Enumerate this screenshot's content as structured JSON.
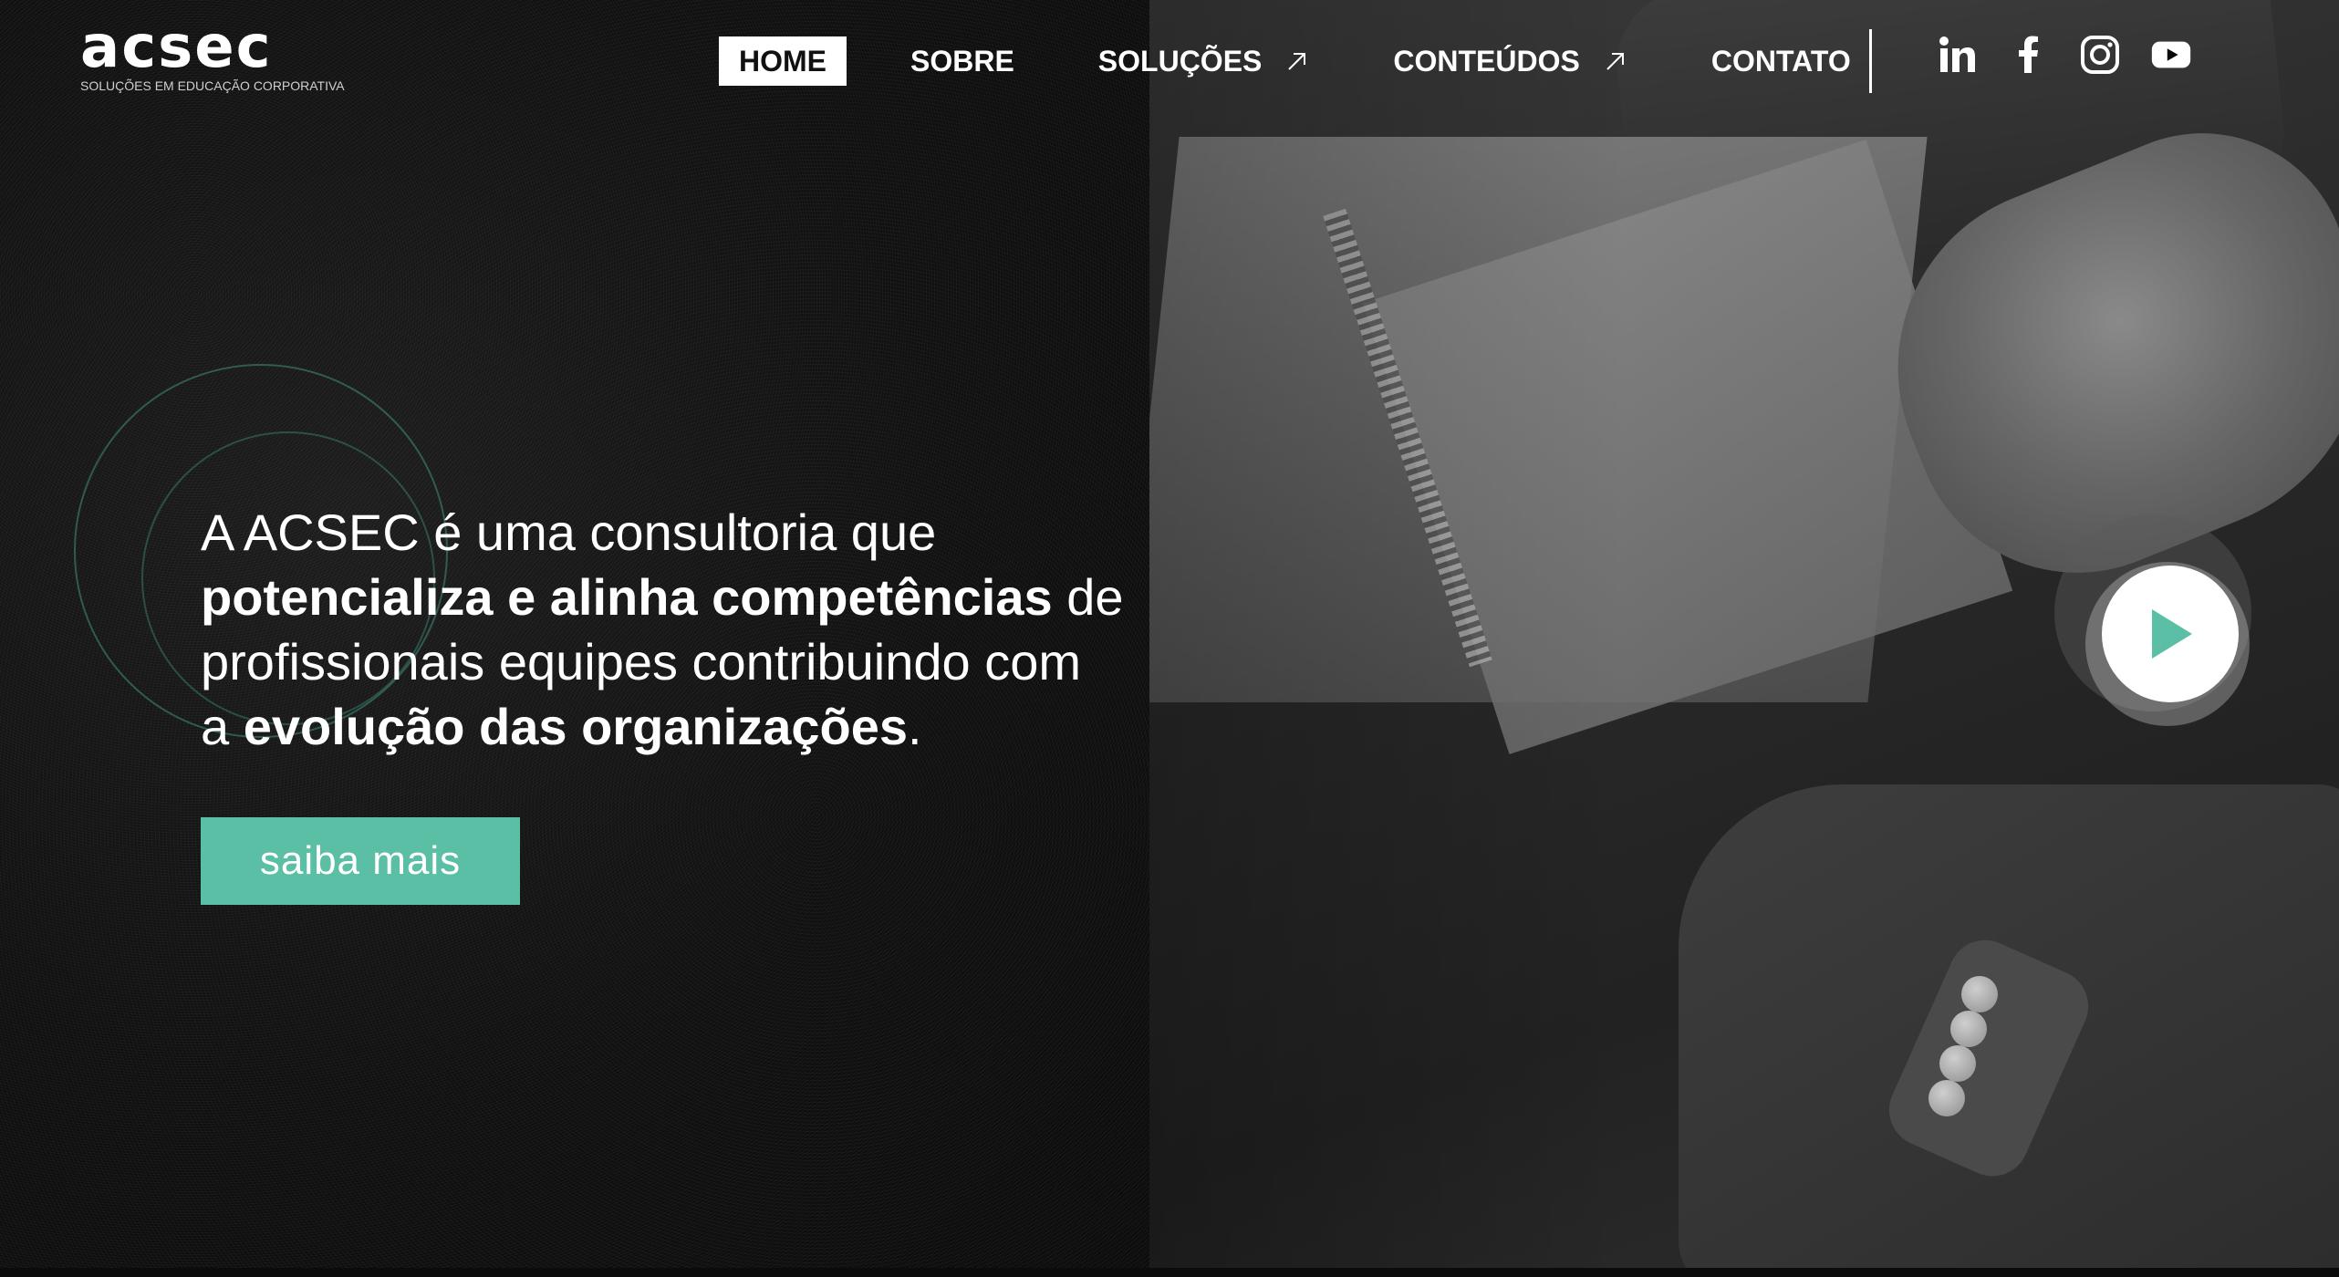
{
  "brand": {
    "logo_text": "acsec",
    "tagline": "SOLUÇÕES EM EDUCAÇÃO CORPORATIVA"
  },
  "nav": {
    "items": [
      {
        "label": "HOME",
        "active": true,
        "external": false
      },
      {
        "label": "SOBRE",
        "active": false,
        "external": false
      },
      {
        "label": "SOLUÇÕES",
        "active": false,
        "external": true
      },
      {
        "label": "CONTEÚDOS",
        "active": false,
        "external": true
      },
      {
        "label": "CONTATO",
        "active": false,
        "external": false
      }
    ]
  },
  "social": {
    "icons": [
      "linkedin-icon",
      "facebook-icon",
      "instagram-icon",
      "youtube-icon"
    ]
  },
  "hero": {
    "line1": "A ACSEC é uma consultoria que",
    "line2_bold": "potencializa e alinha competências",
    "line2_rest": " de",
    "line3": "profissionais equipes contribuindo com",
    "line4_start": "a ",
    "line4_bold": "evolução das organizações",
    "line4_end": ".",
    "cta_label": "saiba mais"
  },
  "colors": {
    "accent": "#5bbfa6",
    "background": "#0a0a0a",
    "text": "#ffffff"
  },
  "video": {
    "play_icon": "play-icon"
  }
}
